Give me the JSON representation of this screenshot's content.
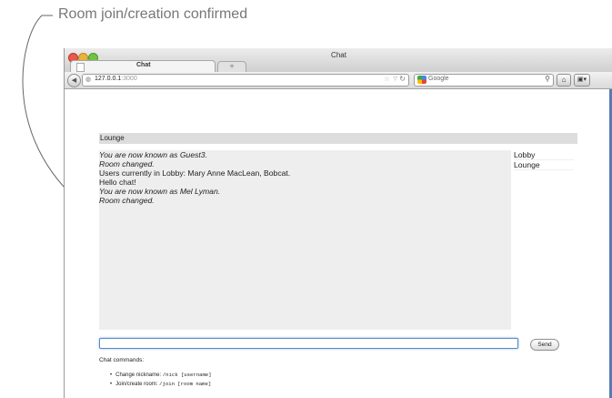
{
  "callout": {
    "text": "Room join/creation confirmed"
  },
  "browser": {
    "window_title": "Chat",
    "tab": {
      "label": "Chat",
      "new_tab_label": "+"
    },
    "url": {
      "host": "127.0.0.1",
      "port": ":3000"
    },
    "search_engine": "Google"
  },
  "chat": {
    "room_name": "Lounge",
    "messages": [
      {
        "text": "You are now known as Guest3.",
        "system": true
      },
      {
        "text": "Room changed.",
        "system": true
      },
      {
        "text": "Users currently in Lobby: Mary Anne MacLean, Bobcat.",
        "system": false
      },
      {
        "text": "Hello chat!",
        "system": false
      },
      {
        "text": "You are now known as Mel Lyman.",
        "system": true
      },
      {
        "text": "Room changed.",
        "system": true
      }
    ],
    "rooms": [
      "Lobby",
      "Lounge"
    ],
    "input_value": "",
    "send_label": "Send",
    "help_title": "Chat commands:",
    "commands": [
      {
        "label": "Change nickname:",
        "syntax": "/nick [username]"
      },
      {
        "label": "Join/create room:",
        "syntax": "/join [room name]"
      }
    ]
  },
  "icons": {
    "back": "back-arrow-icon",
    "site": "globe-icon",
    "bookmark": "star-icon",
    "reload": "reload-icon",
    "search": "search-icon",
    "home": "home-icon"
  },
  "colors": {
    "room_header_bg": "#dddddd",
    "messages_bg": "#eeeeee",
    "input_focus": "#5a8ac4",
    "callout_text": "#777777"
  }
}
